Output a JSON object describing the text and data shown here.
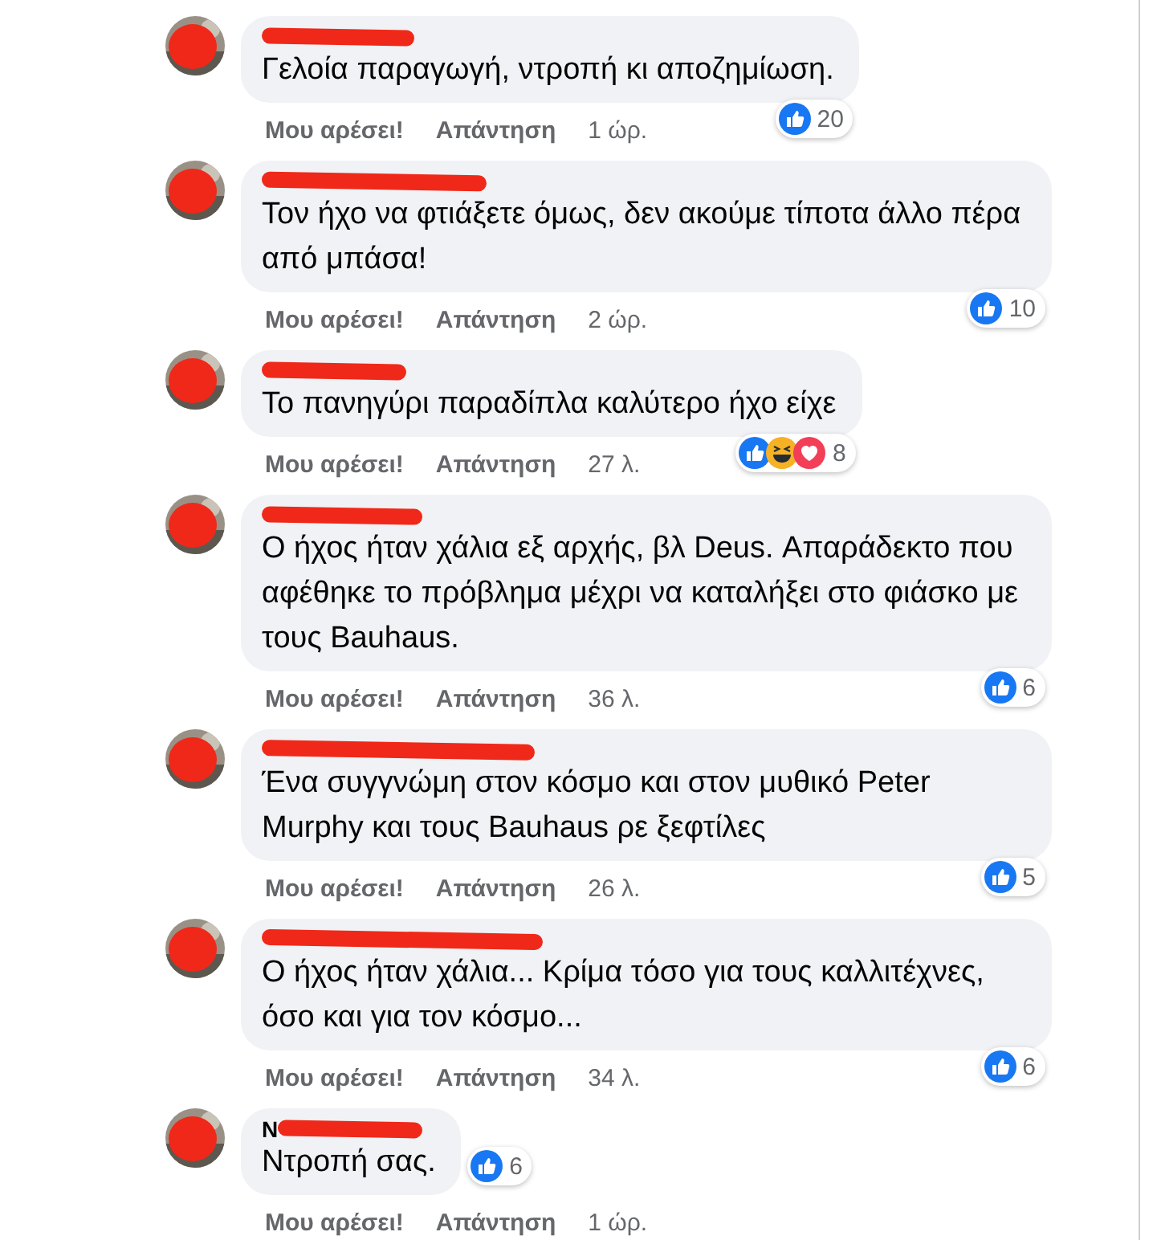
{
  "comments": [
    {
      "text": "Γελοία παραγωγή, ντροπή κι αποζημίωση.",
      "like_label": "Μου αρέσει!",
      "reply_label": "Απάντηση",
      "time": "1 ώρ.",
      "reactions": [
        {
          "kind": "like"
        }
      ],
      "reaction_count": "20"
    },
    {
      "text": "Τον ήχο να φτιάξετε όμως, δεν ακούμε τίποτα άλλο πέρα από μπάσα!",
      "like_label": "Μου αρέσει!",
      "reply_label": "Απάντηση",
      "time": "2 ώρ.",
      "reactions": [
        {
          "kind": "like"
        }
      ],
      "reaction_count": "10"
    },
    {
      "text": "Το πανηγύρι παραδίπλα καλύτερο ήχο είχε",
      "like_label": "Μου αρέσει!",
      "reply_label": "Απάντηση",
      "time": "27 λ.",
      "reactions": [
        {
          "kind": "like"
        },
        {
          "kind": "haha"
        },
        {
          "kind": "love"
        }
      ],
      "reaction_count": "8"
    },
    {
      "text": "Ο ήχος ήταν χάλια εξ αρχής, βλ Deus. Απαράδεκτο που αφέθηκε το πρόβλημα μέχρι να καταλήξει στο φιάσκο με τους Bauhaus.",
      "like_label": "Μου αρέσει!",
      "reply_label": "Απάντηση",
      "time": "36 λ.",
      "reactions": [
        {
          "kind": "like"
        }
      ],
      "reaction_count": "6"
    },
    {
      "text": "Ένα συγγνώμη στον κόσμο και στον μυθικό Peter Murphy και τους Bauhaus ρε ξεφτίλες",
      "like_label": "Μου αρέσει!",
      "reply_label": "Απάντηση",
      "time": "26 λ.",
      "reactions": [
        {
          "kind": "like"
        }
      ],
      "reaction_count": "5"
    },
    {
      "text": "Ο ήχος ήταν χάλια... Κρίμα τόσο για τους καλλιτέχνες, όσο και για τον κόσμο...",
      "like_label": "Μου αρέσει!",
      "reply_label": "Απάντηση",
      "time": "34 λ.",
      "reactions": [
        {
          "kind": "like"
        }
      ],
      "reaction_count": "6"
    },
    {
      "name": "N",
      "text": "Ντροπή σας.",
      "like_label": "Μου αρέσει!",
      "reply_label": "Απάντηση",
      "time": "1 ώρ.",
      "reactions": [
        {
          "kind": "like"
        }
      ],
      "reaction_count": "6"
    }
  ]
}
